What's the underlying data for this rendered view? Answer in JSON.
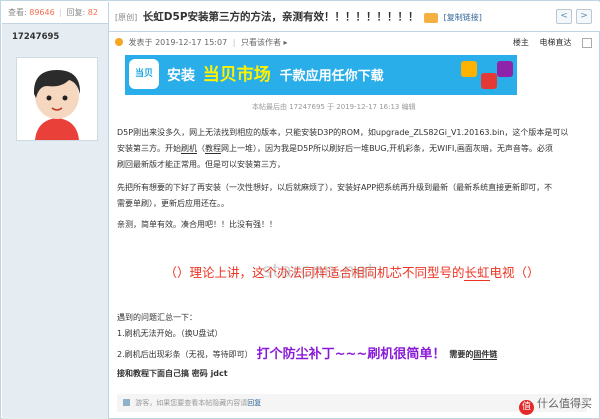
{
  "user_panel": {
    "views_label": "查看:",
    "views_count": "89646",
    "separator": "|",
    "replies_label": "回复:",
    "replies_count": "82",
    "username": "17247695"
  },
  "thread": {
    "tag": "[原创]",
    "title": "长虹D5P安装第三方的方法，亲测有效！！！！！！！！！",
    "copy_link": "[复制链接]",
    "prev_button": "<",
    "next_button": ">",
    "posted": "发表于 2019-12-17 15:07",
    "separator": "|",
    "only_author": "只看该作者",
    "only_author_arrow": "▸",
    "floor": "楼主",
    "elevator": "电梯直达"
  },
  "banner": {
    "logo": "当贝",
    "text1": "安装",
    "text2": "当贝市场",
    "text3": "千款应用任你下载",
    "bg_color": "#29aee9",
    "highlight_color": "#fff200"
  },
  "edit_note": "本帖最后由 17247695 于 2019-12-17 16:13 编辑",
  "body": {
    "p1_line1": "D5P刚出来没多久，网上无法找到相应的版本，只能安装D3P的ROM，如upgrade_ZLS82Gi_V1.20163.bin，这个版本是可以",
    "p1_line2_a": "安装第三方。开始",
    "p1_line2_link1": "刷机",
    "p1_line2_b": "（",
    "p1_line2_link2": "教程",
    "p1_line2_c": "网上一堆），因为我是D5P所以刷好后一堆BUG,开机彩条，无WIFI,画面灰暗，无声音等。必须",
    "p1_line3": "刷回最新版才能正常用。但是可以安装第三方，",
    "p2_line1": "先把所有想要的下好了再安装（一次性想好，以后就麻烦了），安装好APP把系统再升级到最新（最新系统直接更新即可，不",
    "p2_line2": "需要单刷），更新后应用还在。。",
    "p3_line1": "亲测，简单有效。凑合用吧！！比没有强！！",
    "red_a": "（）理论上讲，这个办法同样适合相同机芯不同型号的",
    "red_link": "长虹",
    "red_b": "电视（）",
    "watermark": "starcnn.net",
    "issues_title": "遇到的问题汇总一下：",
    "issue1": "1.刷机无法开始。（换U盘试）",
    "issue2_a": "2.刷机后出现彩条（无视，等待即可）",
    "slogan": "打个防尘补丁~~~刷机很简单！",
    "issue2_b": "需要的",
    "issue2_link": "固件链",
    "issue2_c": "接和教程下面自己搞 密码 jdct"
  },
  "footer": {
    "text": "游客，如果您要查看本帖隐藏内容请",
    "link": "回复"
  },
  "watermark_logo": {
    "mark": "值",
    "text": "什么值得买"
  },
  "colors": {
    "border": "#c2d5e3",
    "side_bg": "#e5edf2",
    "red_text": "#ee3322",
    "purple_text": "#8a1ad9"
  }
}
